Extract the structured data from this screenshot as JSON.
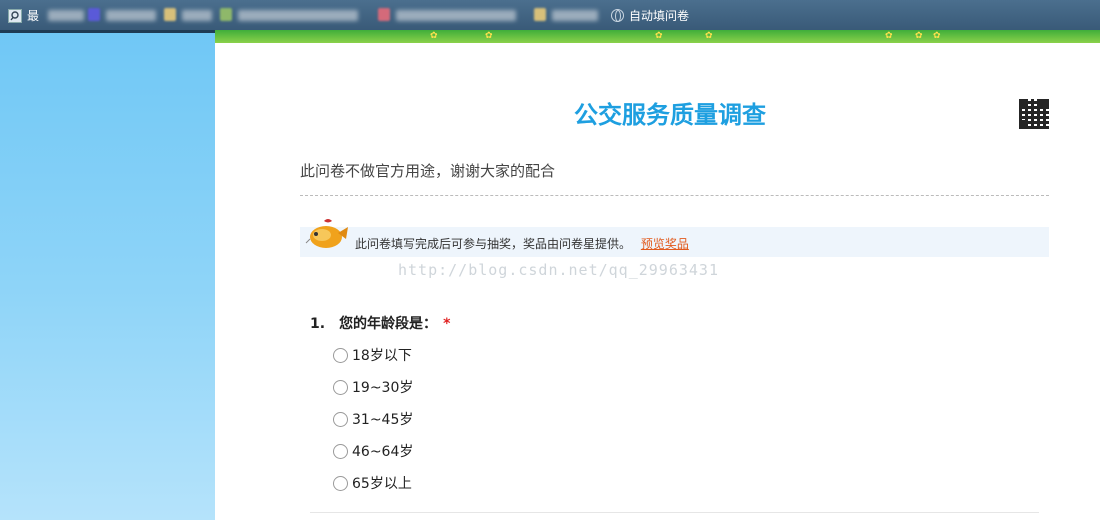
{
  "bookmarks": {
    "first_label": "最",
    "last_label": "自动填问卷"
  },
  "survey": {
    "title": "公交服务质量调查",
    "intro": "此问卷不做官方用途，谢谢大家的配合",
    "notice_text": "此问卷填写完成后可参与抽奖，奖品由问卷星提供。",
    "notice_link": "预览奖品",
    "watermark": "http://blog.csdn.net/qq_29963431",
    "question": {
      "number": "1.",
      "text": "您的年龄段是：",
      "required_mark": "*",
      "options": [
        "18岁以下",
        "19~30岁",
        "31~45岁",
        "46~64岁",
        "65岁以上"
      ]
    }
  },
  "colors": {
    "title": "#1e9fe0",
    "link": "#e25a1d",
    "required": "#e02020",
    "notice_bg": "#eef5fc"
  },
  "icons": [
    "search-icon",
    "globe-icon",
    "qr-code-icon",
    "mascot-icon",
    "radio-icon"
  ]
}
